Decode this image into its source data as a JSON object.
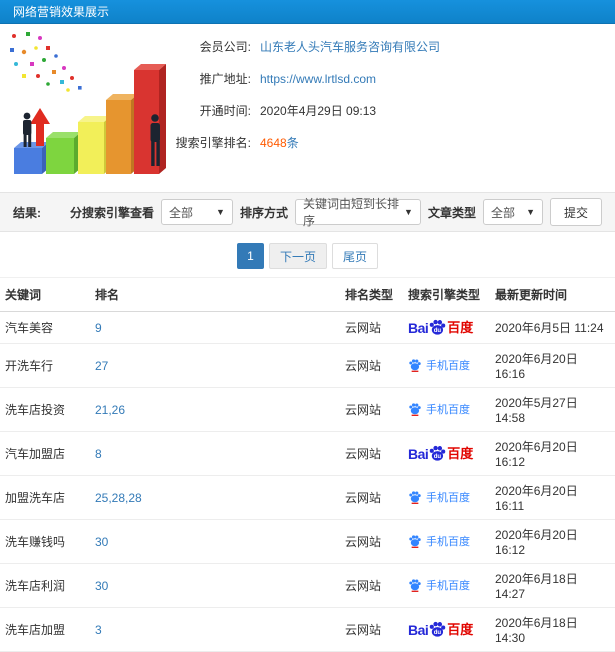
{
  "header": {
    "title": "网络营销效果展示"
  },
  "info": {
    "member_label": "会员公司:",
    "member_value": "山东老人头汽车服务咨询有限公司",
    "url_label": "推广地址:",
    "url_value": "https://www.lrtlsd.com",
    "open_label": "开通时间:",
    "open_value": "2020年4月29日 09:13",
    "rank_label": "搜索引擎排名:",
    "rank_count": "4648",
    "rank_unit": "条"
  },
  "filter": {
    "result_label": "结果:",
    "engine_filter_label": "分搜索引擎查看",
    "engine_filter_value": "全部",
    "sort_label": "排序方式",
    "sort_value": "关键词由短到长排序",
    "article_label": "文章类型",
    "article_value": "全部",
    "submit_label": "提交",
    "caret": "▼"
  },
  "pagination": {
    "current": "1",
    "next": "下一页",
    "last": "尾页"
  },
  "table": {
    "headers": [
      "关键词",
      "排名",
      "排名类型",
      "搜索引擎类型",
      "最新更新时间"
    ],
    "rows": [
      {
        "keyword": "汽车美容",
        "rank": "9",
        "rank_type": "云网站",
        "engine": "baidu",
        "updated": "2020年6月5日 11:24"
      },
      {
        "keyword": "开洗车行",
        "rank": "27",
        "rank_type": "云网站",
        "engine": "mobile",
        "updated": "2020年6月20日 16:16"
      },
      {
        "keyword": "洗车店投资",
        "rank": "21,26",
        "rank_type": "云网站",
        "engine": "mobile",
        "updated": "2020年5月27日 14:58"
      },
      {
        "keyword": "汽车加盟店",
        "rank": "8",
        "rank_type": "云网站",
        "engine": "baidu",
        "updated": "2020年6月20日 16:12"
      },
      {
        "keyword": "加盟洗车店",
        "rank": "25,28,28",
        "rank_type": "云网站",
        "engine": "mobile",
        "updated": "2020年6月20日 16:11"
      },
      {
        "keyword": "洗车赚钱吗",
        "rank": "30",
        "rank_type": "云网站",
        "engine": "mobile",
        "updated": "2020年6月20日 16:12"
      },
      {
        "keyword": "洗车店利润",
        "rank": "30",
        "rank_type": "云网站",
        "engine": "mobile",
        "updated": "2020年6月18日 14:27"
      },
      {
        "keyword": "洗车店加盟",
        "rank": "3",
        "rank_type": "云网站",
        "engine": "baidu",
        "updated": "2020年6月18日 14:30"
      }
    ]
  },
  "engines": {
    "baidu": {
      "bai": "Bai",
      "du": "du",
      "name": "百度"
    },
    "mobile": {
      "name": "手机百度"
    }
  },
  "colors": {
    "header_bg": "#1389d3",
    "link": "#337ab7",
    "highlight": "#ff5a00",
    "baidu_blue": "#2529d8",
    "baidu_red": "#e10601",
    "mobile_blue": "#3385ff"
  }
}
